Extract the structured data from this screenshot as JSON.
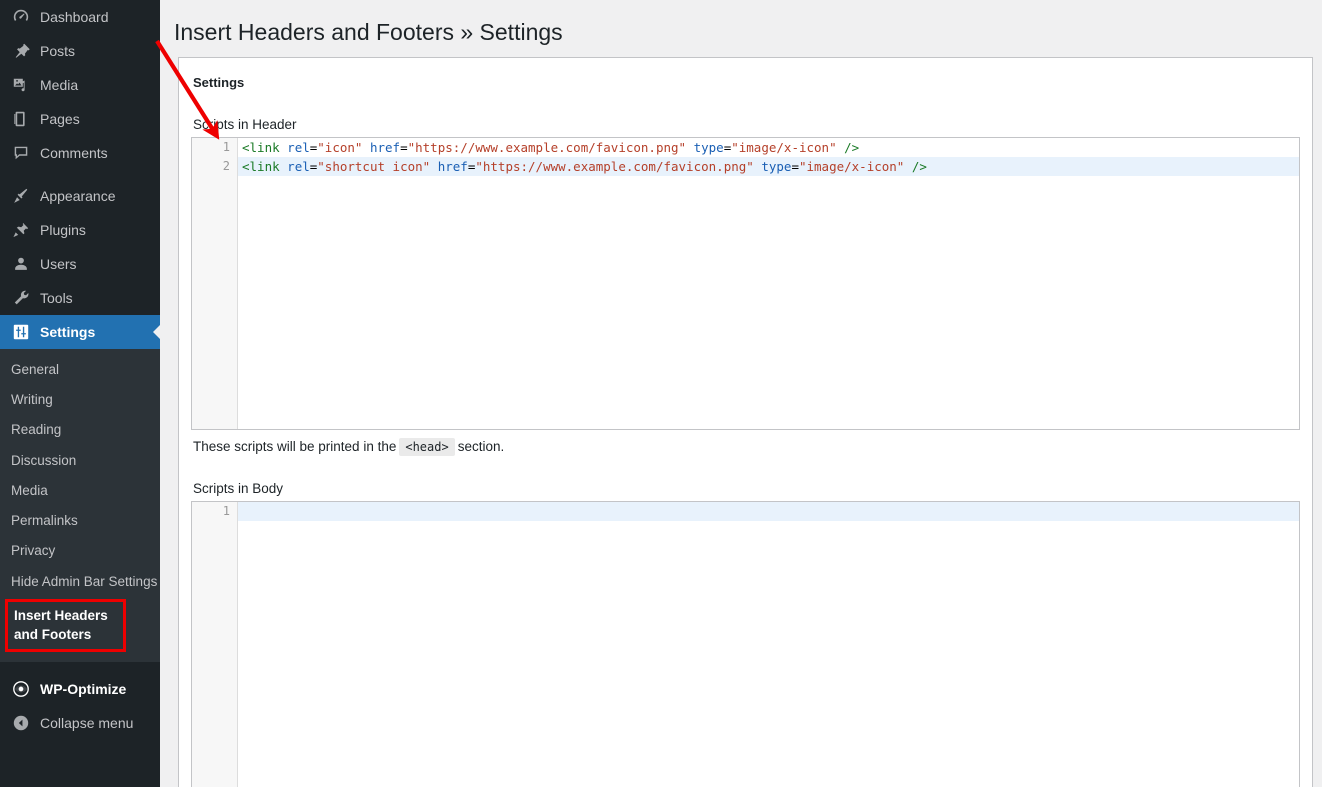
{
  "sidebar": {
    "primary_items": [
      {
        "label": "Dashboard",
        "icon": "dashboard-icon"
      },
      {
        "label": "Posts",
        "icon": "pin-icon"
      },
      {
        "label": "Media",
        "icon": "media-icon"
      },
      {
        "label": "Pages",
        "icon": "pages-icon"
      },
      {
        "label": "Comments",
        "icon": "comment-icon"
      },
      {
        "label": "Appearance",
        "icon": "brush-icon"
      },
      {
        "label": "Plugins",
        "icon": "plug-icon"
      },
      {
        "label": "Users",
        "icon": "user-icon"
      },
      {
        "label": "Tools",
        "icon": "wrench-icon"
      },
      {
        "label": "Settings",
        "icon": "sliders-icon"
      }
    ],
    "active_item": "Settings",
    "submenu_items": [
      {
        "label": "General"
      },
      {
        "label": "Writing"
      },
      {
        "label": "Reading"
      },
      {
        "label": "Discussion"
      },
      {
        "label": "Media"
      },
      {
        "label": "Permalinks"
      },
      {
        "label": "Privacy"
      },
      {
        "label": "Hide Admin Bar Settings"
      },
      {
        "label": "Insert Headers and Footers",
        "highlighted": true
      }
    ],
    "bottom_items": [
      {
        "label": "WP-Optimize",
        "icon": "eye-icon"
      },
      {
        "label": "Collapse menu",
        "icon": "arrow-left-circle-icon"
      }
    ]
  },
  "page": {
    "title": "Insert Headers and Footers » Settings",
    "panel_heading": "Settings"
  },
  "header_field": {
    "label": "Scripts in Header",
    "help_prefix": "These scripts will be printed in the",
    "help_code": "<head>",
    "help_suffix": "section.",
    "lines": [
      {
        "number": "1",
        "active": false,
        "tokens": [
          {
            "t": "tag",
            "v": "<link"
          },
          {
            "t": "plain",
            "v": " "
          },
          {
            "t": "attr",
            "v": "rel"
          },
          {
            "t": "plain",
            "v": "="
          },
          {
            "t": "str",
            "v": "\"icon\""
          },
          {
            "t": "plain",
            "v": " "
          },
          {
            "t": "attr",
            "v": "href"
          },
          {
            "t": "plain",
            "v": "="
          },
          {
            "t": "str",
            "v": "\"https://www.example.com/favicon.png\""
          },
          {
            "t": "plain",
            "v": " "
          },
          {
            "t": "attr",
            "v": "type"
          },
          {
            "t": "plain",
            "v": "="
          },
          {
            "t": "str",
            "v": "\"image/x-icon\""
          },
          {
            "t": "plain",
            "v": " "
          },
          {
            "t": "punct",
            "v": "/>"
          }
        ]
      },
      {
        "number": "2",
        "active": true,
        "tokens": [
          {
            "t": "tag",
            "v": "<link"
          },
          {
            "t": "plain",
            "v": " "
          },
          {
            "t": "attr",
            "v": "rel"
          },
          {
            "t": "plain",
            "v": "="
          },
          {
            "t": "str",
            "v": "\"shortcut icon\""
          },
          {
            "t": "plain",
            "v": " "
          },
          {
            "t": "attr",
            "v": "href"
          },
          {
            "t": "plain",
            "v": "="
          },
          {
            "t": "str",
            "v": "\"https://www.example.com/favicon.png\""
          },
          {
            "t": "plain",
            "v": " "
          },
          {
            "t": "attr",
            "v": "type"
          },
          {
            "t": "plain",
            "v": "="
          },
          {
            "t": "str",
            "v": "\"image/x-icon\""
          },
          {
            "t": "plain",
            "v": " "
          },
          {
            "t": "punct",
            "v": "/>"
          }
        ]
      }
    ]
  },
  "body_field": {
    "label": "Scripts in Body",
    "lines": [
      {
        "number": "1",
        "active": true,
        "tokens": []
      }
    ]
  },
  "annotation": {
    "arrow_color": "#ee0000",
    "highlight_box_color": "#ee0000"
  },
  "colors": {
    "sidebar_bg": "#1d2327",
    "submenu_bg": "#2c3338",
    "accent_blue": "#2271b1",
    "page_bg": "#f0f0f1",
    "active_line": "#e8f2fc"
  }
}
